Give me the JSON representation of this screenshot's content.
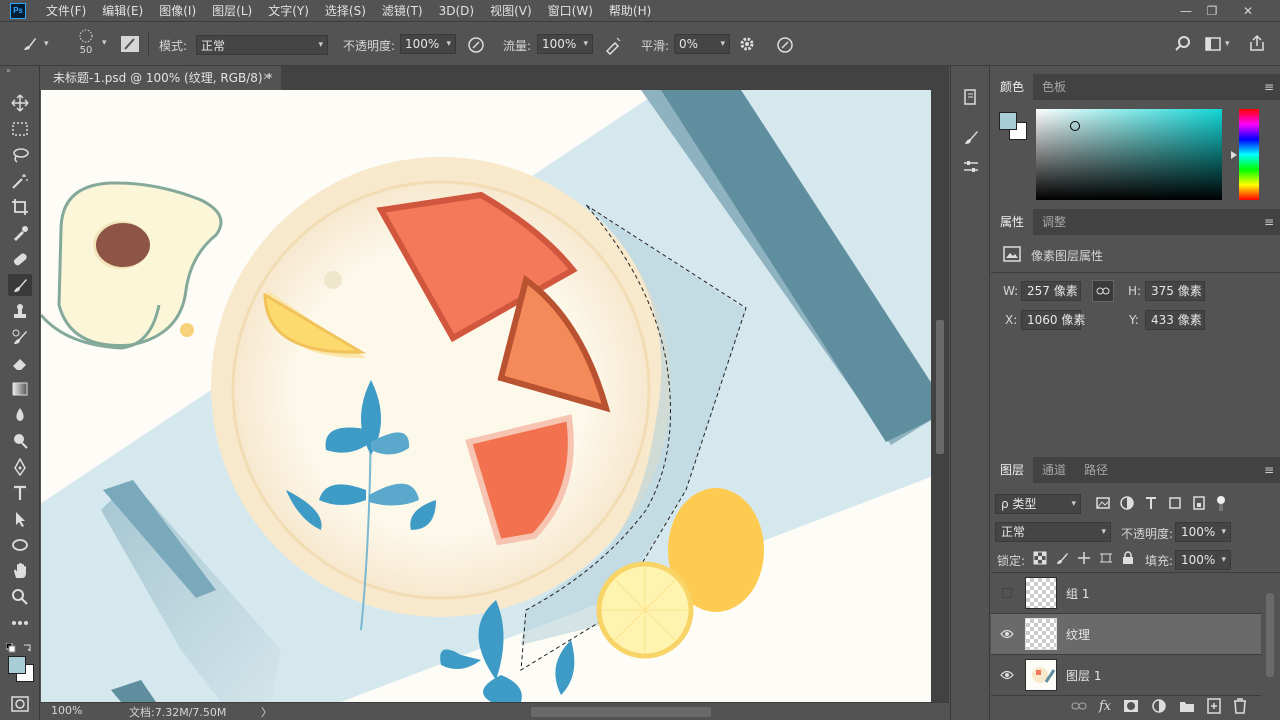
{
  "menubar": {
    "logo": "Ps",
    "items": [
      "文件(F)",
      "编辑(E)",
      "图像(I)",
      "图层(L)",
      "文字(Y)",
      "选择(S)",
      "滤镜(T)",
      "3D(D)",
      "视图(V)",
      "窗口(W)",
      "帮助(H)"
    ],
    "minimize": "—",
    "restore": "❐",
    "close": "✕"
  },
  "options": {
    "brush_size": "50",
    "mode_label": "模式:",
    "mode_value": "正常",
    "opacity_label": "不透明度:",
    "opacity_value": "100%",
    "flow_label": "流量:",
    "flow_value": "100%",
    "smoothing_label": "平滑:",
    "smoothing_value": "0%"
  },
  "document": {
    "tab_title": "未标题-1.psd @ 100% (纹理, RGB/8) *",
    "tab_close": "✕",
    "zoom": "100%",
    "doc_size": "文档:7.32M/7.50M",
    "status_arrow": "〉"
  },
  "color_panel": {
    "tabs": [
      "颜色",
      "色板"
    ],
    "foreground": "#a9cdd7",
    "background": "#ffffff"
  },
  "properties_panel": {
    "tabs": [
      "属性",
      "调整"
    ],
    "title": "像素图层属性",
    "w_label": "W:",
    "w_value": "257 像素",
    "h_label": "H:",
    "h_value": "375 像素",
    "x_label": "X:",
    "x_value": "1060 像素",
    "y_label": "Y:",
    "y_value": "433 像素"
  },
  "layers_panel": {
    "tabs": [
      "图层",
      "通道",
      "路径"
    ],
    "filter_label": "ρ 类型",
    "blend_mode": "正常",
    "opacity_label": "不透明度:",
    "opacity_value": "100%",
    "lock_label": "锁定:",
    "fill_label": "填充:",
    "fill_value": "100%",
    "layers": [
      {
        "name": "组 1",
        "visible": false,
        "selected": false
      },
      {
        "name": "纹理",
        "visible": true,
        "selected": true
      },
      {
        "name": "图层 1",
        "visible": true,
        "selected": false
      }
    ]
  },
  "icons": {
    "tools": [
      "move-icon",
      "marquee-icon",
      "lasso-icon",
      "magic-wand-icon",
      "crop-icon",
      "eyedropper-icon",
      "healing-brush-icon",
      "brush-icon",
      "clone-stamp-icon",
      "history-brush-icon",
      "eraser-icon",
      "gradient-icon",
      "blur-icon",
      "dodge-icon",
      "pen-icon",
      "type-icon",
      "path-select-icon",
      "ellipse-icon",
      "hand-icon",
      "zoom-icon",
      "more-tools-icon"
    ]
  },
  "colors": {
    "ui_bg": "#535353",
    "panel_dark": "#424242",
    "canvas_bg": "#fdfcf6",
    "selected_layer": "#6a6a6a"
  }
}
